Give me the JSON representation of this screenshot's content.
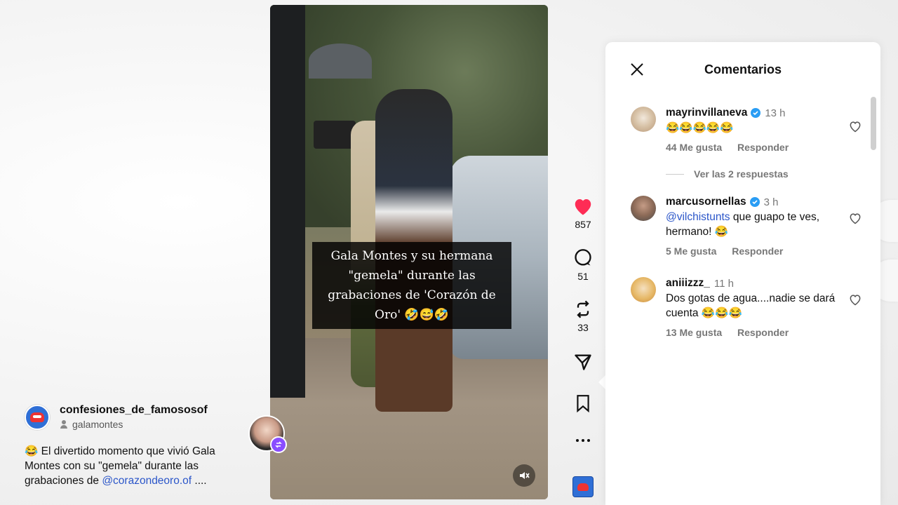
{
  "caption": {
    "account_name": "confesiones_de_famososof",
    "tagged_user": "galamontes",
    "text_prefix": "😂 El divertido momento que vivió Gala Montes con su \"gemela\" durante las grabaciones de ",
    "mention": "@corazondeoro.of",
    "text_suffix": " ...."
  },
  "video": {
    "overlay_text": "Gala Montes y su hermana \"gemela\" durante las grabaciones de 'Corazón de Oro' 🤣😅🤣",
    "mute_icon": "volume-muted-icon"
  },
  "actions": {
    "likes": "857",
    "comments": "51",
    "reposts": "33",
    "like_color": "#fe2c55"
  },
  "comments_panel": {
    "title": "Comentarios",
    "comments": [
      {
        "user": "mayrinvillaneva",
        "verified": true,
        "time": "13 h",
        "text": "😂😂😂😂😂",
        "likes": "44 Me gusta",
        "reply": "Responder",
        "view_replies": "Ver las 2 respuestas"
      },
      {
        "user": "marcusornellas",
        "verified": true,
        "time": "3 h",
        "mention": "@vilchistunts",
        "text": " que guapo te ves, hermano! 😂",
        "likes": "5 Me gusta",
        "reply": "Responder"
      },
      {
        "user": "aniiizzz_",
        "verified": false,
        "time": "11 h",
        "text": "Dos gotas de agua....nadie se dará cuenta 😂😂😂",
        "likes": "13 Me gusta",
        "reply": "Responder"
      }
    ]
  }
}
